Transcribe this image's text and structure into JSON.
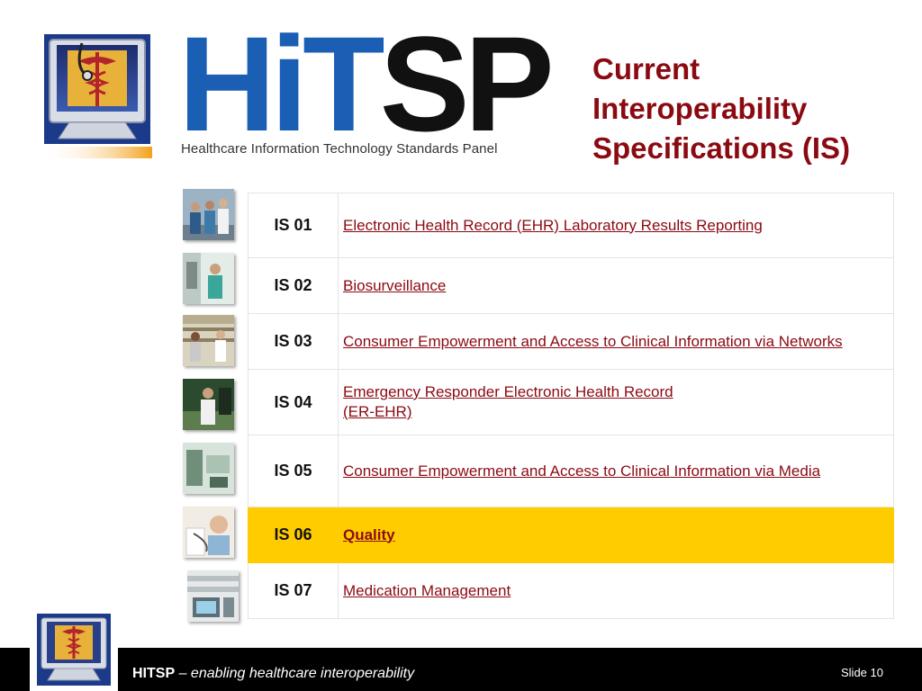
{
  "header": {
    "logo_text_hi": "HiT",
    "logo_text_sp": "SP",
    "logo_tagline": "Healthcare Information Technology Standards Panel",
    "title_lines": [
      "Current",
      "Interoperability",
      "Specifications (IS)"
    ]
  },
  "specs": [
    {
      "id": "IS 01",
      "name_lines": [
        "Electronic Health Record (EHR) Laboratory Results Reporting"
      ]
    },
    {
      "id": "IS 02",
      "name_lines": [
        "Biosurveillance"
      ]
    },
    {
      "id": "IS 03",
      "name_lines": [
        "Consumer Empowerment and Access to Clinical Information via Networks"
      ]
    },
    {
      "id": "IS 04",
      "name_lines": [
        "Emergency Responder Electronic Health Record",
        "(ER-EHR)"
      ]
    },
    {
      "id": "IS 05",
      "name_lines": [
        "Consumer Empowerment and Access to Clinical Information via Media"
      ]
    },
    {
      "id": "IS 06",
      "name_lines": [
        "Quality"
      ]
    },
    {
      "id": "IS 07",
      "name_lines": [
        "Medication Management"
      ]
    }
  ],
  "highlighted_spec": "IS 06",
  "colors": {
    "title": "#8b0a12",
    "link": "#8b0a12",
    "highlight": "#ffcc00",
    "logo_blue": "#1a5fb4",
    "footer": "#000000"
  },
  "icons": {
    "header_logo": "monitor-caduceus-icon",
    "footer_logo": "monitor-caduceus-icon"
  },
  "footer": {
    "brand": "HITSP",
    "separator": " – ",
    "tagline": "enabling healthcare interoperability",
    "slide_label": "Slide 10"
  }
}
